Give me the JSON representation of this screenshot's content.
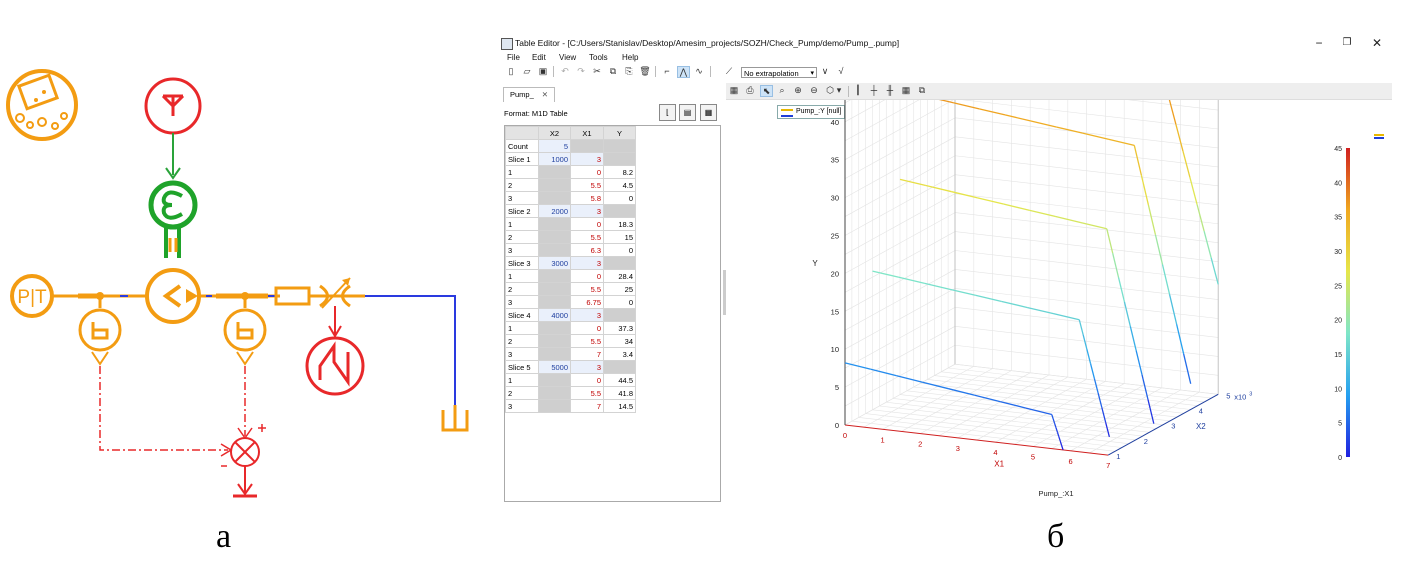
{
  "schematic": {
    "pt_label": "P|T"
  },
  "figure_labels": {
    "left": "а",
    "right": "б"
  },
  "window": {
    "title": "Table Editor - [C:/Users/Stanislav/Desktop/Amesim_projects/SOZH/Check_Pump/demo/Pump_.pump]",
    "controls": {
      "minimize": "−",
      "restore": "❐",
      "close": "✕"
    },
    "menu": [
      "File",
      "Edit",
      "View",
      "Tools",
      "Help"
    ],
    "extrapolation": "No extrapolation"
  },
  "left_panel": {
    "tab_label": "Pump_",
    "tab_close": "✕",
    "format_label": "Format: M1D Table",
    "table": {
      "headers": [
        "",
        "X2",
        "X1",
        "Y"
      ],
      "count_label": "Count",
      "count_value": "5",
      "slices": [
        {
          "label": "Slice 1",
          "x2": "1000",
          "n": "3",
          "rows": [
            {
              "i": "1",
              "x1": "0",
              "y": "8.2"
            },
            {
              "i": "2",
              "x1": "5.5",
              "y": "4.5"
            },
            {
              "i": "3",
              "x1": "5.8",
              "y": "0"
            }
          ]
        },
        {
          "label": "Slice 2",
          "x2": "2000",
          "n": "3",
          "rows": [
            {
              "i": "1",
              "x1": "0",
              "y": "18.3"
            },
            {
              "i": "2",
              "x1": "5.5",
              "y": "15"
            },
            {
              "i": "3",
              "x1": "6.3",
              "y": "0"
            }
          ]
        },
        {
          "label": "Slice 3",
          "x2": "3000",
          "n": "3",
          "rows": [
            {
              "i": "1",
              "x1": "0",
              "y": "28.4"
            },
            {
              "i": "2",
              "x1": "5.5",
              "y": "25"
            },
            {
              "i": "3",
              "x1": "6.75",
              "y": "0"
            }
          ]
        },
        {
          "label": "Slice 4",
          "x2": "4000",
          "n": "3",
          "rows": [
            {
              "i": "1",
              "x1": "0",
              "y": "37.3"
            },
            {
              "i": "2",
              "x1": "5.5",
              "y": "34"
            },
            {
              "i": "3",
              "x1": "7",
              "y": "3.4"
            }
          ]
        },
        {
          "label": "Slice 5",
          "x2": "5000",
          "n": "3",
          "rows": [
            {
              "i": "1",
              "x1": "0",
              "y": "44.5"
            },
            {
              "i": "2",
              "x1": "5.5",
              "y": "41.8"
            },
            {
              "i": "3",
              "x1": "7",
              "y": "14.5"
            }
          ]
        }
      ]
    }
  },
  "plot": {
    "legend_label": "Pump_:Y [null]"
  },
  "chart_data": {
    "type": "line",
    "xlabel": "X1",
    "ylabel": "Y",
    "zlabel": "X2",
    "caption": "Pump_:X1",
    "z_multiplier": "x10",
    "z_exponent": "3",
    "xlim": [
      0,
      7
    ],
    "ylim": [
      0,
      45
    ],
    "zlim": [
      1,
      5
    ],
    "x_ticks": [
      "0",
      "1",
      "2",
      "3",
      "4",
      "5",
      "6",
      "7"
    ],
    "y_ticks": [
      "0",
      "5",
      "10",
      "15",
      "20",
      "25",
      "30",
      "35",
      "40",
      "45"
    ],
    "z_ticks": [
      "1",
      "2",
      "3",
      "4",
      "5"
    ],
    "colorbar_ticks": [
      "0",
      "5",
      "10",
      "15",
      "20",
      "25",
      "30",
      "35",
      "40",
      "45"
    ],
    "grid": true,
    "series": [
      {
        "z": 1,
        "x": [
          0,
          5.5,
          5.8
        ],
        "y": [
          8.2,
          4.5,
          0
        ]
      },
      {
        "z": 2,
        "x": [
          0,
          5.5,
          6.3
        ],
        "y": [
          18.3,
          15,
          0
        ]
      },
      {
        "z": 3,
        "x": [
          0,
          5.5,
          6.75
        ],
        "y": [
          28.4,
          25,
          0
        ]
      },
      {
        "z": 4,
        "x": [
          0,
          5.5,
          7
        ],
        "y": [
          37.3,
          34,
          3.4
        ]
      },
      {
        "z": 5,
        "x": [
          0,
          5.5,
          7
        ],
        "y": [
          44.5,
          41.8,
          14.5
        ]
      }
    ],
    "colormap": [
      "#2020e0",
      "#25a0f0",
      "#7fe6c8",
      "#e6e64a",
      "#f0a820",
      "#d02020"
    ]
  }
}
